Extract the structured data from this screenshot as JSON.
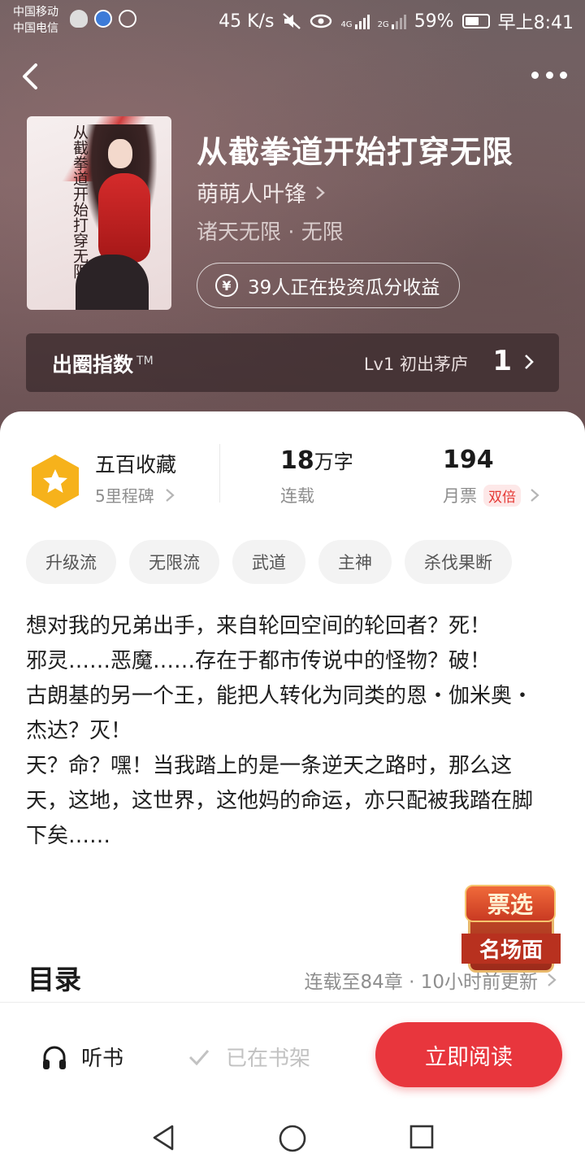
{
  "status_bar": {
    "carrier1": "中国移动",
    "carrier2": "中国电信",
    "network_speed": "45 K/s",
    "signal1_label": "4G",
    "signal2_label": "2G",
    "battery": "59%",
    "time": "早上8:41"
  },
  "book": {
    "title": "从截拳道开始打穿无限",
    "author": "萌萌人叶锋",
    "genre": "诸天无限 · 无限",
    "invest_text": "39人正在投资瓜分收益",
    "cover_text": "从截拳道开始打穿无限"
  },
  "circle_index": {
    "label": "出圈指数",
    "tm": "TM",
    "level_text": "Lv1 初出茅庐",
    "level_num": "1"
  },
  "stats": {
    "collect_title": "五百收藏",
    "collect_sub": "5里程碑",
    "words_value": "18",
    "words_unit": "万字",
    "words_sub": "连载",
    "votes_value": "194",
    "votes_sub": "月票",
    "votes_badge": "双倍"
  },
  "tags": [
    "升级流",
    "无限流",
    "武道",
    "主神",
    "杀伐果断"
  ],
  "synopsis": "想对我的兄弟出手，来自轮回空间的轮回者？死！\n邪灵……恶魔……存在于都市传说中的怪物？破！\n古朗基的另一个王，能把人转化为同类的恩・伽米奥・杰达？灭！\n天？命？嘿！当我踏上的是一条逆天之路时，那么这天，这地，这世界，这他妈的命运，亦只配被我踏在脚下矣……",
  "toc": {
    "title": "目录",
    "info": "连载至84章 · 10小时前更新"
  },
  "promo": {
    "line1": "票选",
    "line2": "名场面"
  },
  "actions": {
    "listen": "听书",
    "shelf": "已在书架",
    "read": "立即阅读"
  },
  "colors": {
    "accent": "#e8363d",
    "badge": "#f6b21b"
  }
}
